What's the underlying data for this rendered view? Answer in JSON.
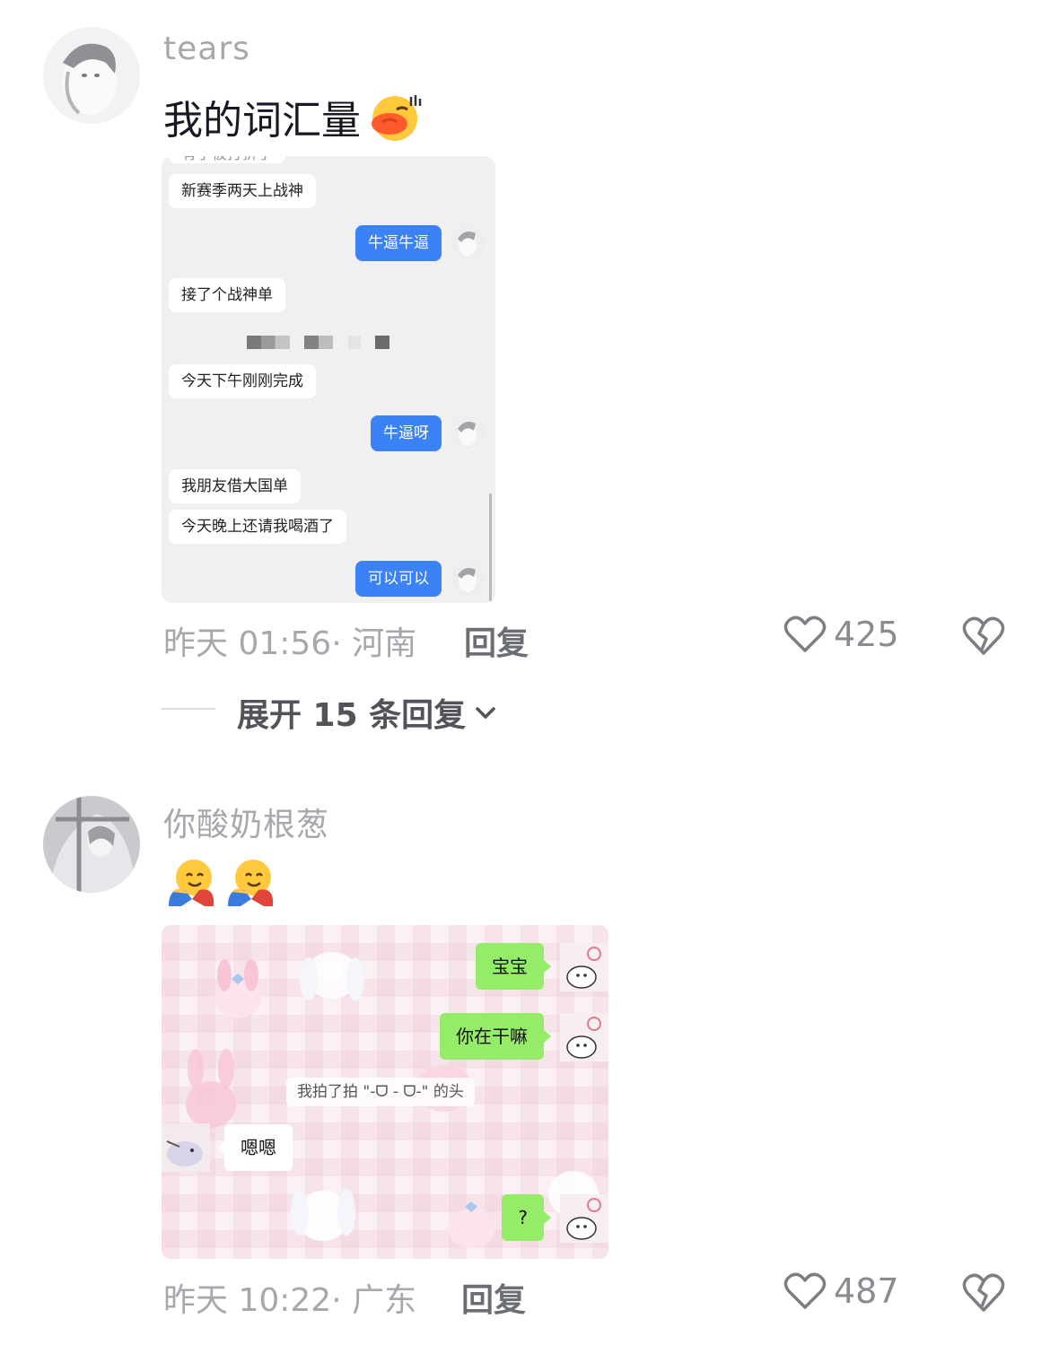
{
  "comments": [
    {
      "username": "tears",
      "text": "我的词汇量",
      "text_emoji": "cool-face-emoji",
      "screenshot": {
        "partial_top_text": "有了被打折了",
        "messages": [
          {
            "side": "left",
            "text": "新赛季两天上战神"
          },
          {
            "side": "right",
            "text": "牛逼牛逼"
          },
          {
            "side": "left",
            "text": "接了个战神单"
          },
          {
            "side": "left",
            "text": "今天下午刚刚完成"
          },
          {
            "side": "right",
            "text": "牛逼呀"
          },
          {
            "side": "left",
            "text": "我朋友借大国单"
          },
          {
            "side": "left",
            "text": "今天晚上还请我喝酒了"
          },
          {
            "side": "right",
            "text": "可以可以"
          }
        ]
      },
      "time": "昨天 01:56· 河南",
      "reply_label": "回复",
      "likes": "425"
    },
    {
      "username": "你酸奶根葱",
      "emojis": [
        "hugging-face-emoji",
        "hugging-face-emoji"
      ],
      "screenshot": {
        "messages": [
          {
            "side": "right",
            "text": "宝宝"
          },
          {
            "side": "right",
            "text": "你在干嘛"
          },
          {
            "side": "system",
            "text": "我拍了拍 \"-ᗜ - ᗜ-\" 的头"
          },
          {
            "side": "left",
            "text": "嗯嗯"
          },
          {
            "side": "right",
            "text": "?"
          }
        ]
      },
      "time": "昨天 10:22· 广东",
      "reply_label": "回复",
      "likes": "487"
    }
  ],
  "expand_replies": "展开 15 条回复",
  "colors": {
    "meta_gray": "#a7a8ae",
    "blue_bubble": "#3b82f6",
    "green_bubble": "#95ec69"
  }
}
